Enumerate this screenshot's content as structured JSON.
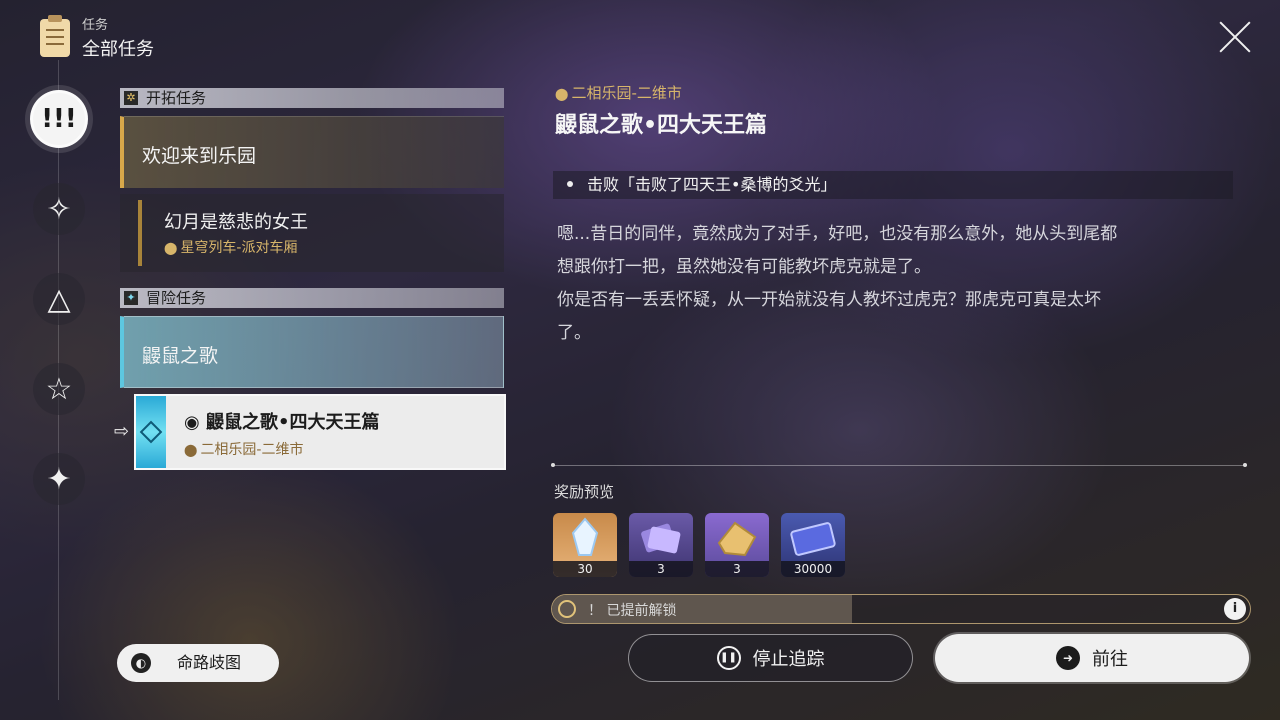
{
  "header": {
    "subtitle": "任务",
    "title": "全部任务"
  },
  "nav": {
    "main_symbol": "!!!",
    "item_symbols": [
      "✧",
      "△",
      "☆",
      "✦"
    ]
  },
  "quest_list": {
    "trailblaze_section": {
      "label": "开拓任务"
    },
    "trailblaze_quest": {
      "title": "欢迎来到乐园"
    },
    "trailblaze_sub": {
      "title": "幻月是慈悲的女王",
      "location": "星穹列车-派对车厢"
    },
    "adventure_section": {
      "label": "冒险任务"
    },
    "adventure_quest": {
      "title": "鼹鼠之歌"
    },
    "adventure_sub": {
      "title": "鼹鼠之歌•四大天王篇",
      "location": "二相乐园-二维市"
    }
  },
  "map_button": {
    "label": "命路歧图"
  },
  "detail": {
    "location": "二相乐园-二维市",
    "title": "鼹鼠之歌•四大天王篇",
    "objective": "击败「击败了四天王•桑博的爻光」",
    "description_lines": [
      "嗯...昔日的同伴，竟然成为了对手，好吧，也没有那么意外，她从头到尾都",
      "想跟你打一把，虽然她没有可能教坏虎克就是了。",
      "你是否有一丢丢怀疑，从一开始就没有人教坏过虎克？那虎克可真是太坏",
      "了。"
    ]
  },
  "rewards": {
    "label": "奖励预览",
    "items": [
      {
        "icon": "crystal-icon",
        "count": "30"
      },
      {
        "icon": "tickets-icon",
        "count": "3"
      },
      {
        "icon": "golden-material-icon",
        "count": "3"
      },
      {
        "icon": "credit-card-icon",
        "count": "30000"
      }
    ]
  },
  "unlock_bar": {
    "text": "！ 已提前解锁",
    "info": "i"
  },
  "buttons": {
    "stop_tracking": "停止追踪",
    "go": "前往"
  }
}
